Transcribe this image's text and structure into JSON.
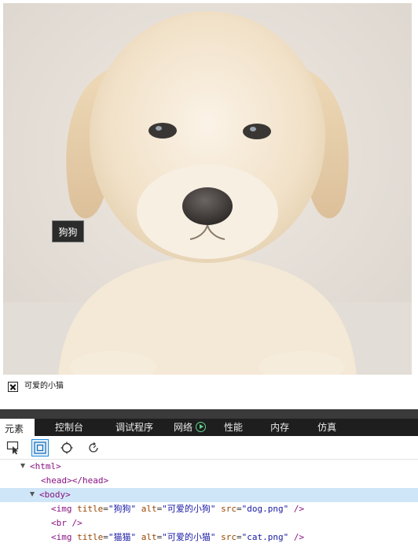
{
  "preview": {
    "tooltip_text": "狗狗",
    "broken_image_alt": "可爱的小猫",
    "dog_image_label": "dog-photo"
  },
  "devtools": {
    "tabs": [
      {
        "label": "元素",
        "active": true
      },
      {
        "label": "控制台",
        "active": false
      },
      {
        "label": "调试程序",
        "active": false
      },
      {
        "label": "网络",
        "active": false
      },
      {
        "label": "性能",
        "active": false
      },
      {
        "label": "内存",
        "active": false
      },
      {
        "label": "仿真",
        "active": false
      }
    ],
    "toolbar_icons": [
      "select-element-icon",
      "box-model-icon",
      "color-picker-icon",
      "refresh-icon"
    ],
    "dom": {
      "html_open": "<html>",
      "head": "<head></head>",
      "body_open": "<body>",
      "img1": {
        "tag": "<img",
        "title_attr": "title",
        "title_val": "\"狗狗\"",
        "alt_attr": "alt",
        "alt_val": "\"可爱的小狗\"",
        "src_attr": "src",
        "src_val": "\"dog.png\"",
        "close": " />"
      },
      "br": "<br />",
      "img2": {
        "tag": "<img",
        "title_attr": "title",
        "title_val": "\"猫猫\"",
        "alt_attr": "alt",
        "alt_val": "\"可爱的小猫\"",
        "src_attr": "src",
        "src_val": "\"cat.png\"",
        "close": " />"
      }
    }
  },
  "colors": {
    "devtools_tabbar": "#1e1e1e",
    "selected_row": "#cfe6f8",
    "tag_color": "#881280",
    "attr_name_color": "#994500",
    "attr_value_color": "#1a1aa6"
  }
}
